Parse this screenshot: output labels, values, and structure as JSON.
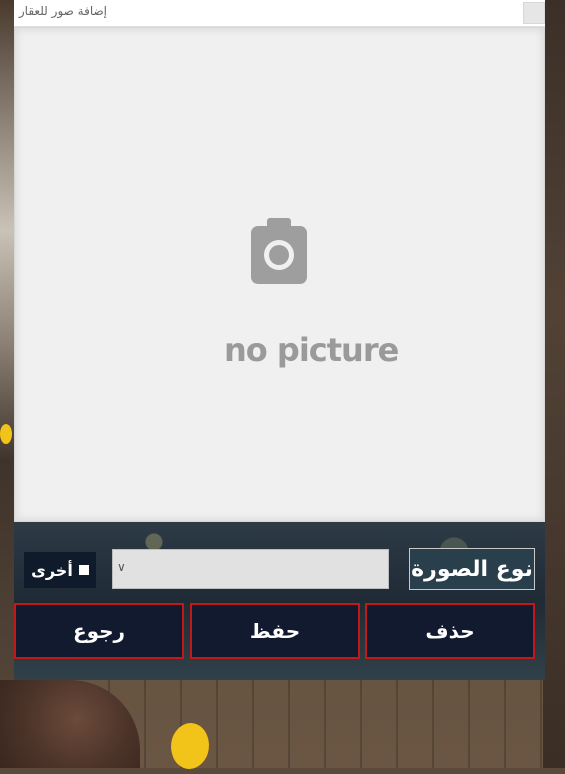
{
  "window": {
    "title": "إضافة صور للعقار"
  },
  "picture": {
    "placeholder_text": "no picture",
    "icon": "camera-icon"
  },
  "form": {
    "other_label": "أخرى",
    "type_label": "نوع الصورة",
    "type_select_value": ""
  },
  "buttons": {
    "back": "رجوع",
    "save": "حفظ",
    "delete": "حذف"
  },
  "colors": {
    "button_border": "#c21818",
    "button_bg": "#111a2e",
    "placeholder_gray": "#9a9a9a"
  }
}
